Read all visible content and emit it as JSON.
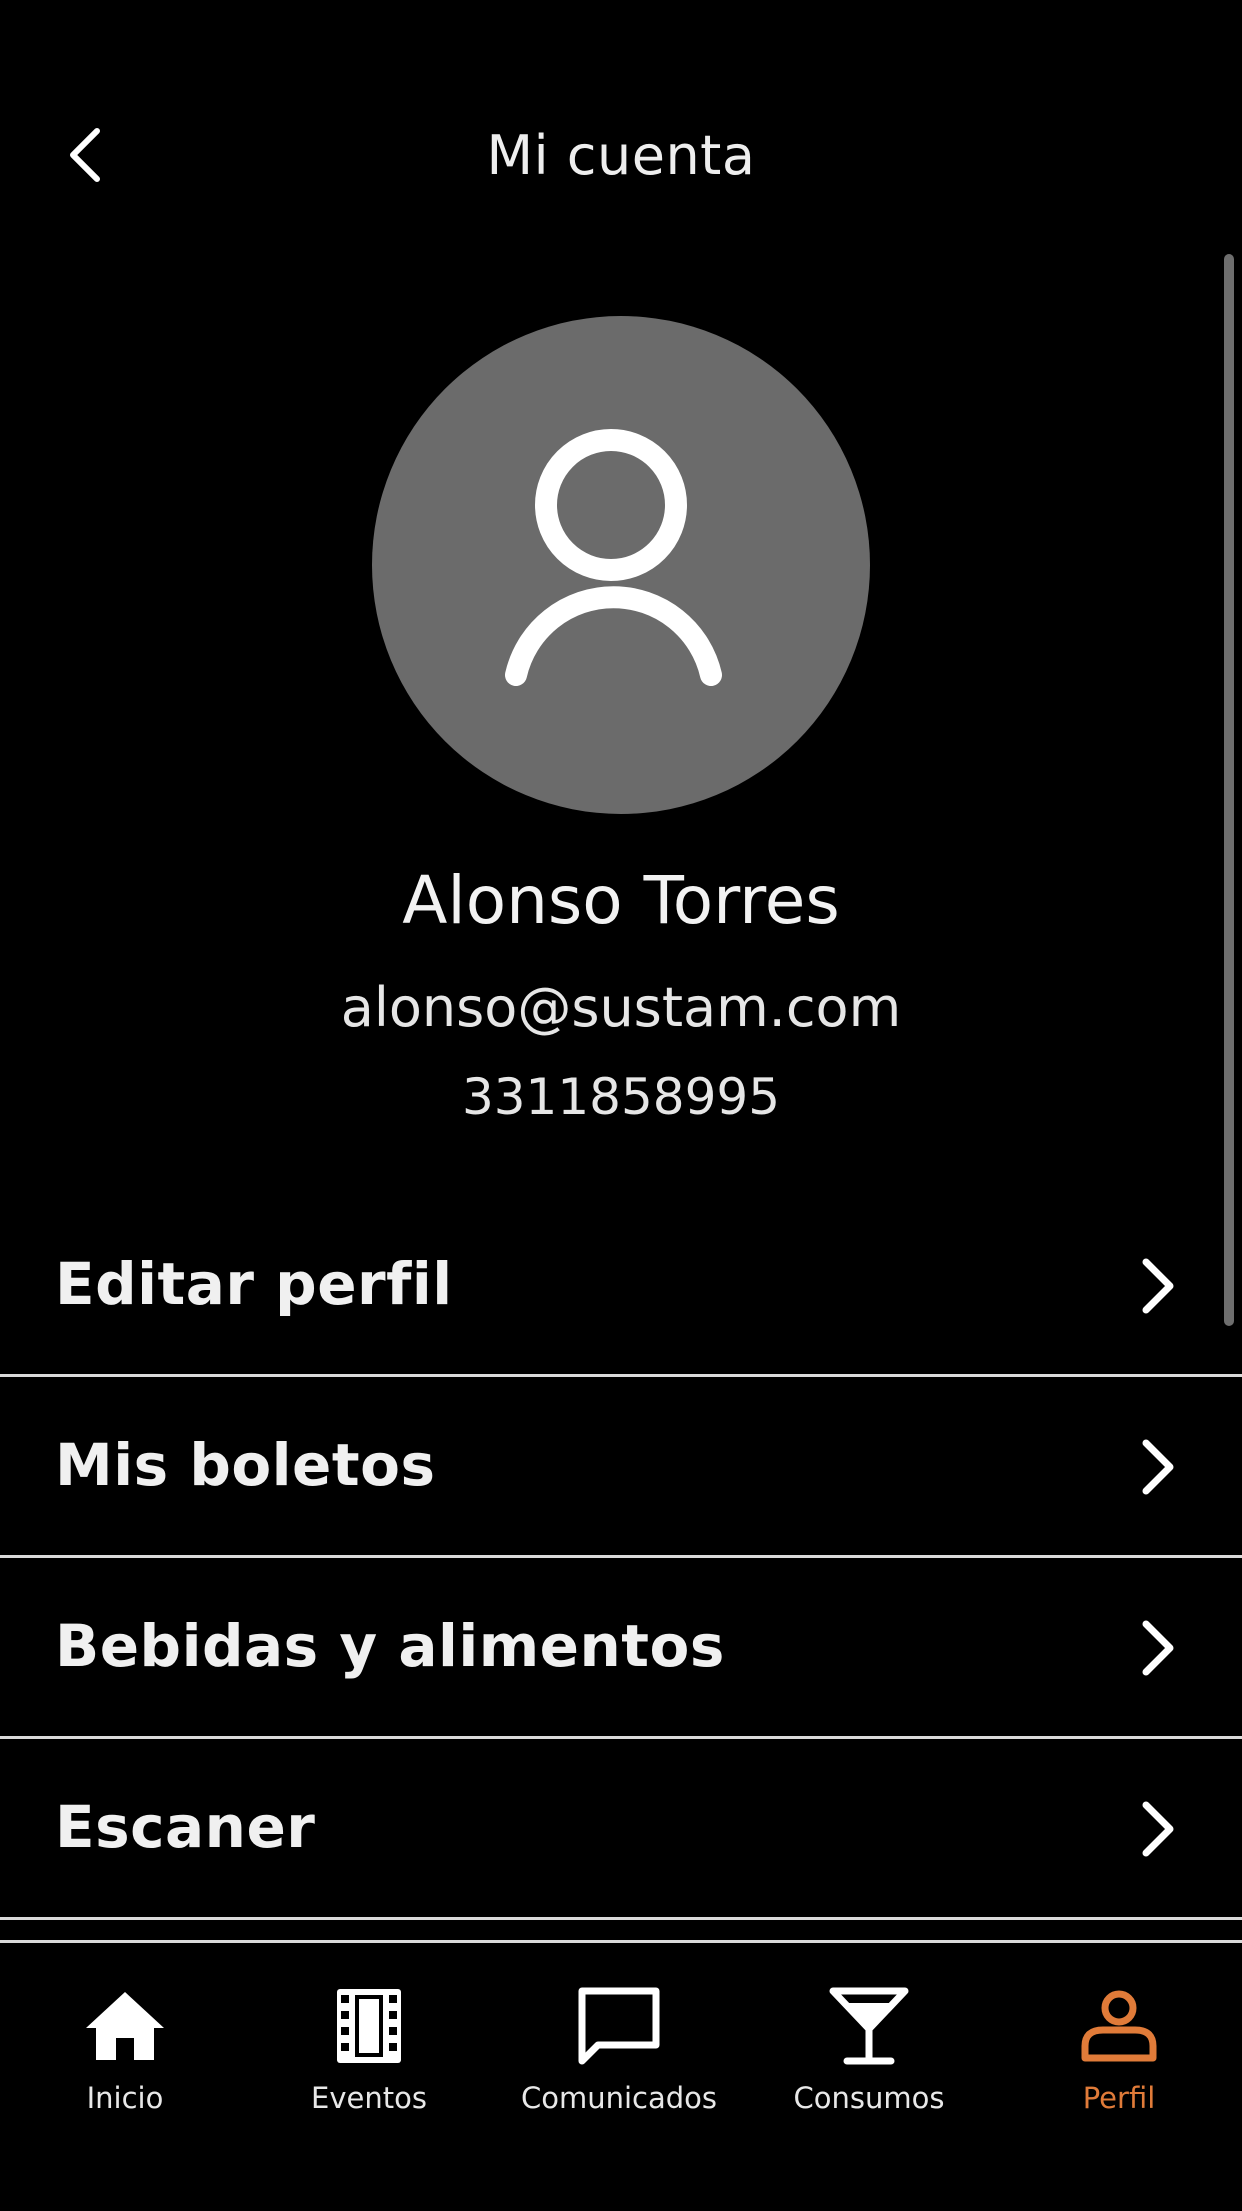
{
  "header": {
    "title": "Mi cuenta",
    "back_icon": "chevron-left-icon"
  },
  "profile": {
    "avatar_icon": "user-outline-icon",
    "name": "Alonso Torres",
    "email": "alonso@sustam.com",
    "phone": "3311858995"
  },
  "menu": {
    "items": [
      {
        "label": "Editar perfil",
        "icon": "chevron-right-icon"
      },
      {
        "label": "Mis boletos",
        "icon": "chevron-right-icon"
      },
      {
        "label": "Bebidas y alimentos",
        "icon": "chevron-right-icon"
      },
      {
        "label": "Escaner",
        "icon": "chevron-right-icon"
      }
    ]
  },
  "tabbar": {
    "active_color": "#e07b39",
    "tabs": [
      {
        "label": "Inicio",
        "icon": "home-icon",
        "active": false
      },
      {
        "label": "Eventos",
        "icon": "film-icon",
        "active": false
      },
      {
        "label": "Comunicados",
        "icon": "chat-bubble-icon",
        "active": false
      },
      {
        "label": "Consumos",
        "icon": "cocktail-glass-icon",
        "active": false
      },
      {
        "label": "Perfil",
        "icon": "person-icon",
        "active": true
      }
    ]
  }
}
